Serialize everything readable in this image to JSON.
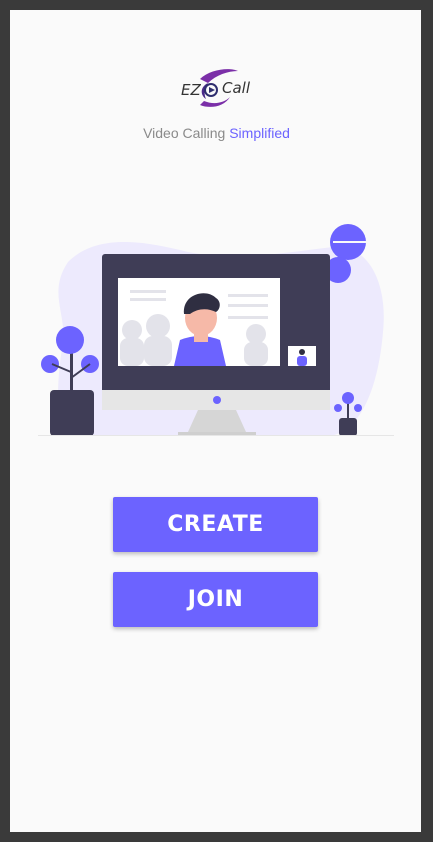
{
  "app": {
    "logo_left": "EZ",
    "logo_right": "Call"
  },
  "tagline": {
    "prefix": "Video Calling",
    "accent": "Simplified"
  },
  "actions": {
    "create_label": "CREATE",
    "join_label": "JOIN"
  },
  "colors": {
    "accent": "#6c63ff",
    "background": "#fafafa",
    "frame": "#3a3a3a",
    "monitor": "#3f3d56",
    "illustration_blob": "#edeafd"
  },
  "icons": {
    "logo": "ez-call-logo-icon",
    "illustration": "video-call-monitor-illustration"
  }
}
